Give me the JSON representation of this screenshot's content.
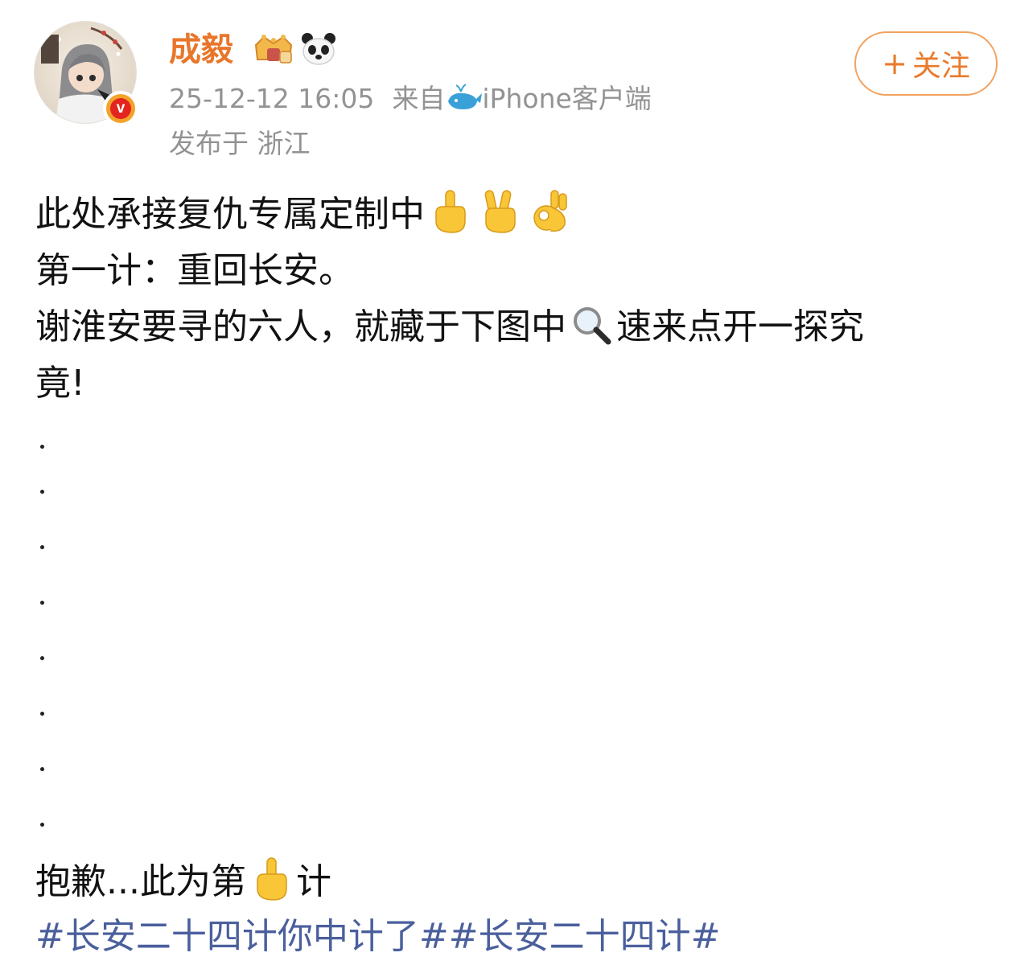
{
  "post": {
    "author_name": "成毅",
    "timestamp": "25-12-12 16:05",
    "source_prefix": "来自",
    "source_client": "iPhone客户端",
    "location_prefix": "发布于",
    "location": "浙江",
    "follow_plus": "+",
    "follow_label": "关注",
    "lines": {
      "line1": "此处承接复仇专属定制中",
      "line2": "第一计：重回长安。",
      "line3a": "谢淮安要寻的六人，就藏于下图中",
      "line3b": "速来点开一探究",
      "line4": "竟!"
    },
    "dot_count": 8,
    "closing": {
      "before": "抱歉...此为第",
      "after": "计"
    },
    "hashtags": [
      "#长安二十四计你中计了#",
      "#长安二十四计#"
    ]
  },
  "icons": {
    "vip_badge": "crown-vip-icon",
    "panda": "panda-icon",
    "whale": "whale-icon",
    "verified": "verified-v-icon",
    "emojis": [
      "index-pointing-up-emoji",
      "victory-hand-emoji",
      "ok-hand-emoji",
      "magnifying-glass-emoji",
      "index-pointing-up-emoji"
    ]
  },
  "colors": {
    "author_name": "#e8762a",
    "follow_border": "#f2a25f",
    "hashtag": "#4a5f9c",
    "meta_text": "#939393",
    "verified_outer": "#f3a32a",
    "verified_inner": "#e4241e"
  }
}
